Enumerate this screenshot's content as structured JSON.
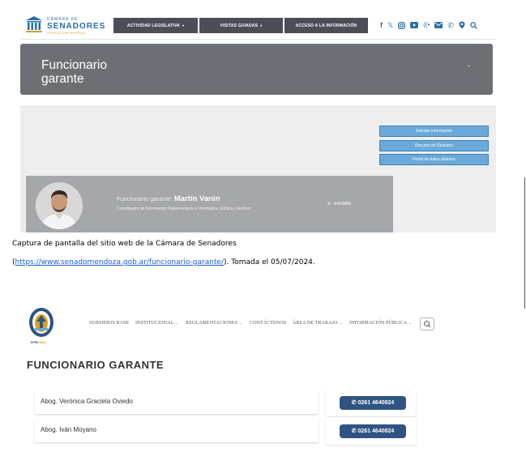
{
  "senado": {
    "logo": {
      "line1": "CÁMARA DE",
      "line2": "SENADORES",
      "line3": "LEGISLATURA MENDOZA"
    },
    "nav": [
      {
        "label": "ACTIVIDAD LEGISLATIVA",
        "caret": "▾"
      },
      {
        "label": "VISITAS GUIADAS",
        "caret": "▾"
      },
      {
        "label": "ACCESO A LA INFORMACIÓN",
        "caret": ""
      }
    ],
    "social_icons": [
      "facebook-icon",
      "x-icon",
      "instagram-icon",
      "youtube-icon",
      "radio-icon",
      "mail-icon",
      "phone-icon",
      "location-icon",
      "search-icon"
    ],
    "banner": {
      "title": "Funcionario garante",
      "dash": "-"
    },
    "buttons": [
      "Solicitar información",
      "Recurso de Reclamo",
      "Portal de datos abiertos"
    ],
    "card": {
      "label": "Funcionario garante:",
      "name": "Martín Vanin",
      "role": "Coordinador de Información Parlamentaria e Informática Jurídica y Archivo",
      "phone": "4493966"
    },
    "colors": {
      "nav": "#4a4f57",
      "banner": "#6c7075",
      "button": "#6aa9d9",
      "card": "#a5a7aa",
      "brand": "#2a6fa8"
    }
  },
  "caption": {
    "line1": "Captura de pantalla del sitio web de la Cámara de Senadores",
    "open": "(",
    "url": "https://www.senadomendoza.gob.ar/funcionario-garante/",
    "rest": "). Tomada el 05/07/2024."
  },
  "epre": {
    "logo": {
      "text_a": "EPRE",
      "text_b": "MZA"
    },
    "nav": [
      {
        "label": "SUBSIDIOS RASE",
        "chevron": ""
      },
      {
        "label": "INSTITUCIONAL",
        "chevron": "⌄"
      },
      {
        "label": "REGLAMENTACIONES",
        "chevron": "⌄"
      },
      {
        "label": "CONTÁCTENOS",
        "chevron": ""
      },
      {
        "label": "ÁREA DE TRABAJO",
        "chevron": "⌄"
      },
      {
        "label": "INFORMACIÓN PÚBLICA",
        "chevron": "⌄"
      }
    ],
    "title": "FUNCIONARIO GARANTE",
    "rows": [
      {
        "name": "Abog. Verónica Graciela Oviedo",
        "phone": "0261 4640824"
      },
      {
        "name": "Abog. Iván Moyano",
        "phone": "0261 4640824"
      }
    ],
    "colors": {
      "pill": "#2f5483",
      "title": "#333333"
    }
  }
}
